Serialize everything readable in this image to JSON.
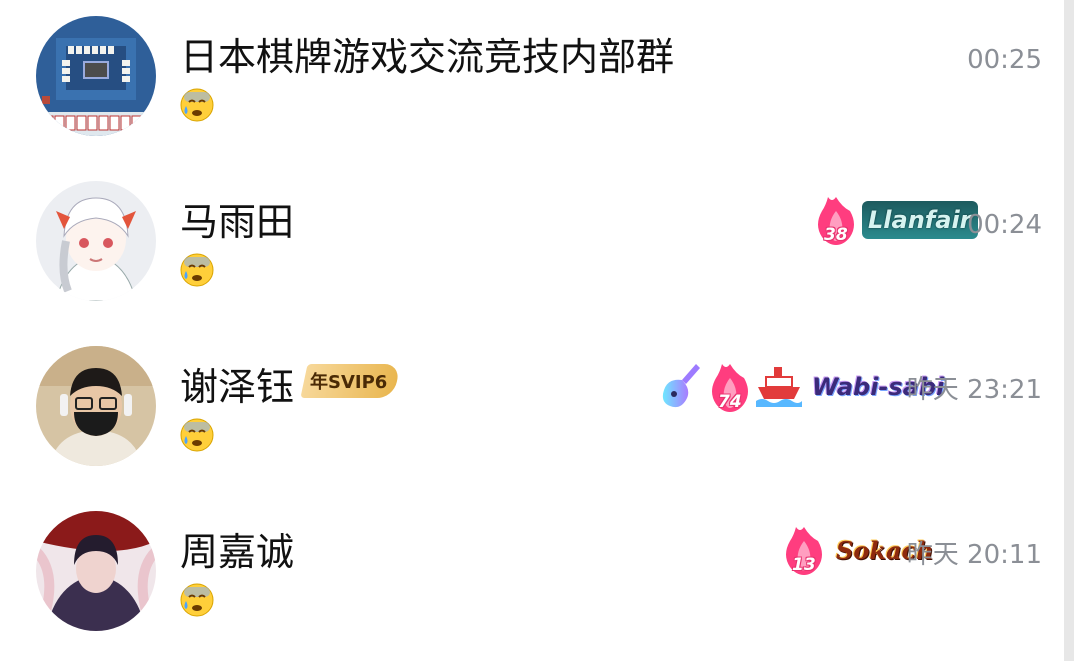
{
  "chats": [
    {
      "name": "日本棋牌游戏交流竞技内部群",
      "avatar_desc": "mahjong-game-avatar",
      "time": "00:25",
      "preview_icon": "anxious-sweat-emoji",
      "badges": []
    },
    {
      "name": "马雨田",
      "avatar_desc": "anime-girl-avatar",
      "time": "00:24",
      "preview_icon": "anxious-sweat-emoji",
      "badges": [
        {
          "type": "flame",
          "level": "38"
        },
        {
          "type": "word",
          "text": "Llanfair"
        }
      ]
    },
    {
      "name": "谢泽钰",
      "avatar_desc": "person-with-mask-avatar",
      "vip": "年SVIP6",
      "time": "昨天 23:21",
      "preview_icon": "anxious-sweat-emoji",
      "badges": [
        {
          "type": "guitar"
        },
        {
          "type": "flame",
          "level": "74"
        },
        {
          "type": "ship"
        },
        {
          "type": "word",
          "text": "Wabi-sabi"
        }
      ]
    },
    {
      "name": "周嘉诚",
      "avatar_desc": "anime-boy-avatar",
      "time": "昨天 20:11",
      "preview_icon": "anxious-sweat-emoji",
      "badges": [
        {
          "type": "flame",
          "level": "13"
        },
        {
          "type": "word",
          "text": "Sokach"
        }
      ]
    }
  ]
}
